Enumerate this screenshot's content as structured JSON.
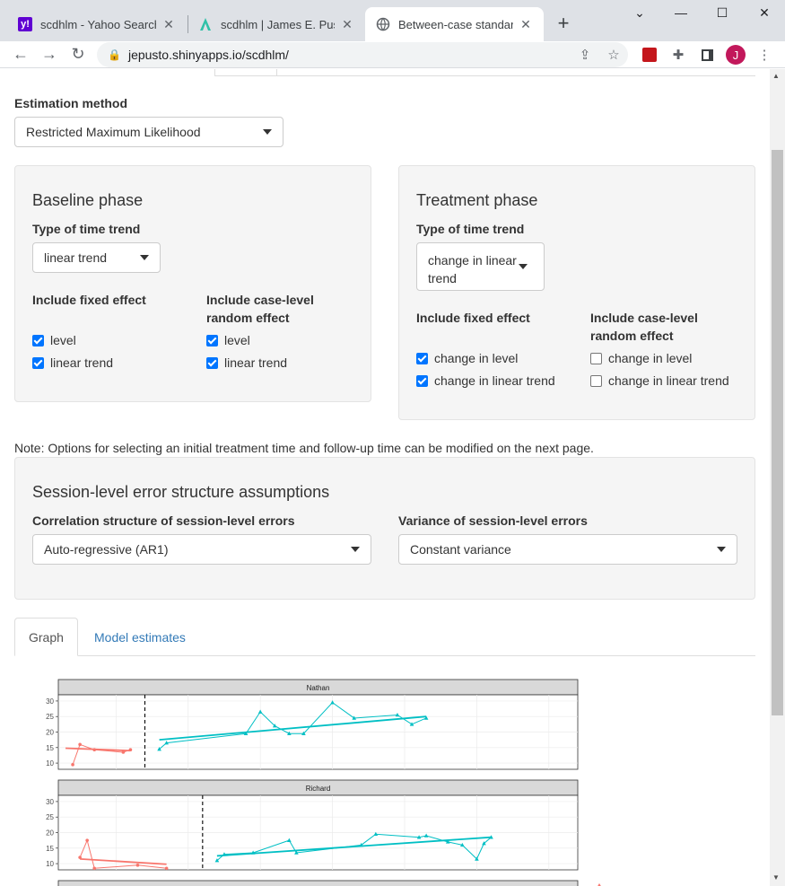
{
  "browser": {
    "tabs": [
      {
        "title": "scdhlm - Yahoo Search Re",
        "icon": "yahoo-icon"
      },
      {
        "title": "scdhlm | James E. Pustejo",
        "icon": "site-a-icon"
      },
      {
        "title": "Between-case standardiz",
        "icon": "globe-icon"
      }
    ],
    "url": "jepusto.shinyapps.io/scdhlm/",
    "avatar_letter": "J"
  },
  "estimation": {
    "label": "Estimation method",
    "value": "Restricted Maximum Likelihood"
  },
  "baseline": {
    "heading": "Baseline phase",
    "trend_label": "Type of time trend",
    "trend_value": "linear trend",
    "fixed_label": "Include fixed effect",
    "random_label_1": "Include case-level",
    "random_label_2": "random effect",
    "fixed_options": [
      {
        "label": "level",
        "checked": true
      },
      {
        "label": "linear trend",
        "checked": true
      }
    ],
    "random_options": [
      {
        "label": "level",
        "checked": true
      },
      {
        "label": "linear trend",
        "checked": true
      }
    ]
  },
  "treatment": {
    "heading": "Treatment phase",
    "trend_label": "Type of time trend",
    "trend_value_1": "change in linear",
    "trend_value_2": "trend",
    "fixed_label": "Include fixed effect",
    "random_label_1": "Include case-level",
    "random_label_2": "random effect",
    "fixed_options": [
      {
        "label": "change in level",
        "checked": true
      },
      {
        "label": "change in linear trend",
        "checked": true
      }
    ],
    "random_options": [
      {
        "label": "change in level",
        "checked": false
      },
      {
        "label": "change in linear trend",
        "checked": false
      }
    ]
  },
  "note": "Note: Options for selecting an initial treatment time and follow-up time can be modified on the next page.",
  "session": {
    "heading": "Session-level error structure assumptions",
    "corr_label": "Correlation structure of session-level errors",
    "corr_value": "Auto-regressive (AR1)",
    "var_label": "Variance of session-level errors",
    "var_value": "Constant variance"
  },
  "tabs": {
    "graph": "Graph",
    "estimates": "Model estimates"
  },
  "colors": {
    "baseline": "#f8766d",
    "treatment": "#00bfc4",
    "strip": "#d9d9d9",
    "link": "#337ab7",
    "checkbox": "#0075ff"
  },
  "chart_data": [
    {
      "type": "line",
      "title": "Nathan",
      "ylim": [
        8,
        32
      ],
      "yticks": [
        10,
        15,
        20,
        25,
        30
      ],
      "xlim": [
        1,
        37
      ],
      "treatment_start": 7,
      "series": [
        {
          "phase": "baseline",
          "marker": "circle",
          "x": [
            2,
            2.5,
            3.5,
            5.5,
            6
          ],
          "y": [
            9.5,
            16,
            14.3,
            13.5,
            14.3
          ],
          "fit": [
            [
              1.5,
              14.8
            ],
            [
              6,
              14.0
            ]
          ]
        },
        {
          "phase": "treatment",
          "marker": "triangle",
          "x": [
            8,
            8.5,
            14,
            15,
            16,
            17,
            18,
            20,
            21.5,
            24.5,
            25.5,
            26.5
          ],
          "y": [
            14.5,
            16.5,
            19.5,
            26.5,
            22,
            19.5,
            19.5,
            29.5,
            24.5,
            25.5,
            22.5,
            24.5
          ],
          "fit": [
            [
              8,
              17.5
            ],
            [
              26.5,
              25.0
            ]
          ]
        }
      ]
    },
    {
      "type": "line",
      "title": "Richard",
      "ylim": [
        8,
        32
      ],
      "yticks": [
        10,
        15,
        20,
        25,
        30
      ],
      "xlim": [
        1,
        37
      ],
      "treatment_start": 11,
      "series": [
        {
          "phase": "baseline",
          "marker": "circle",
          "x": [
            2.5,
            3,
            3.5,
            6.5,
            8.5
          ],
          "y": [
            12,
            17.5,
            8.5,
            9.5,
            8.5
          ],
          "fit": [
            [
              2.5,
              11.5
            ],
            [
              8.5,
              9.8
            ]
          ]
        },
        {
          "phase": "treatment",
          "marker": "triangle",
          "x": [
            12,
            12.5,
            14.5,
            17,
            17.5,
            22,
            23,
            26,
            26.5,
            28,
            29,
            30,
            30.5,
            31
          ],
          "y": [
            11,
            13,
            13.5,
            17.5,
            13.5,
            16,
            19.5,
            18.5,
            19,
            17,
            16,
            11.5,
            16.5,
            18.5
          ],
          "fit": [
            [
              12,
              12.5
            ],
            [
              31,
              18.5
            ]
          ]
        }
      ]
    }
  ]
}
